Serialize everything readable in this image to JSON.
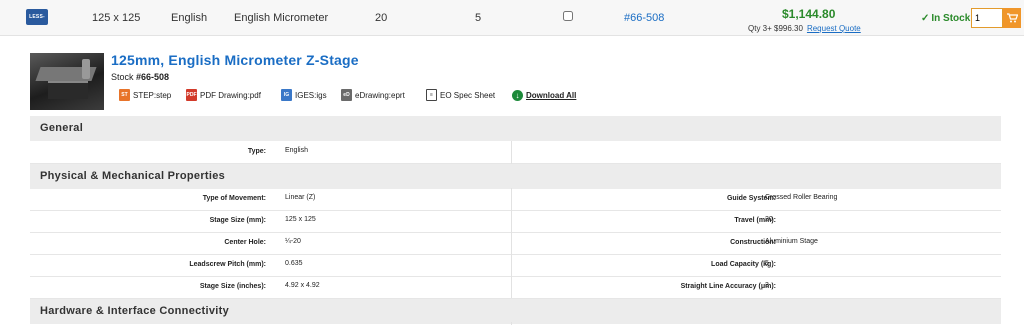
{
  "top_row": {
    "badge_text": "LESS-",
    "size": "125 x 125",
    "units": "English",
    "actuator": "English Micrometer",
    "travel": "20",
    "capacity": "5",
    "stock_number": "#66-508",
    "price": "$1,144.80",
    "qty_price_label": "Qty 3+ $996.30",
    "request_quote": "Request Quote",
    "availability": "In Stock",
    "qty_value": "1",
    "colors": {
      "price": "#2a8a2a",
      "link": "#1a6dc4",
      "cart": "#f0962a"
    }
  },
  "product": {
    "title": "125mm, English Micrometer Z-Stage",
    "stock_label": "Stock",
    "stock_number": "#66-508",
    "downloads": [
      {
        "label": "STEP:step",
        "icon": "step-file-icon"
      },
      {
        "label": "PDF Drawing:pdf",
        "icon": "pdf-file-icon"
      },
      {
        "label": "IGES:igs",
        "icon": "iges-file-icon"
      },
      {
        "label": "eDrawing:eprt",
        "icon": "edrawing-file-icon"
      },
      {
        "label": "EO Spec Sheet",
        "icon": "spec-sheet-icon"
      },
      {
        "label": "Download All",
        "icon": "download-all-icon"
      }
    ]
  },
  "sections": {
    "general": {
      "title": "General",
      "rows": [
        {
          "label": "Type:",
          "value": "English"
        }
      ]
    },
    "physical": {
      "title": "Physical & Mechanical Properties",
      "rows": [
        {
          "left_label": "Type of Movement:",
          "left_value": "Linear (Z)",
          "right_label": "Guide System:",
          "right_value": "Crossed Roller Bearing"
        },
        {
          "left_label": "Stage Size (mm):",
          "left_value": "125 x 125",
          "right_label": "Travel (mm):",
          "right_value": "20"
        },
        {
          "left_label": "Center Hole:",
          "left_value": "¼-20",
          "right_label": "Construction:",
          "right_value": "Aluminium Stage"
        },
        {
          "left_label": "Leadscrew Pitch (mm):",
          "left_value": "0.635",
          "right_label": "Load Capacity (kg):",
          "right_value": "5"
        },
        {
          "left_label": "Stage Size (inches):",
          "left_value": "4.92 x 4.92",
          "right_label": "Straight Line Accuracy (μm):",
          "right_value": "3"
        }
      ]
    },
    "hardware": {
      "title": "Hardware & Interface Connectivity"
    }
  }
}
